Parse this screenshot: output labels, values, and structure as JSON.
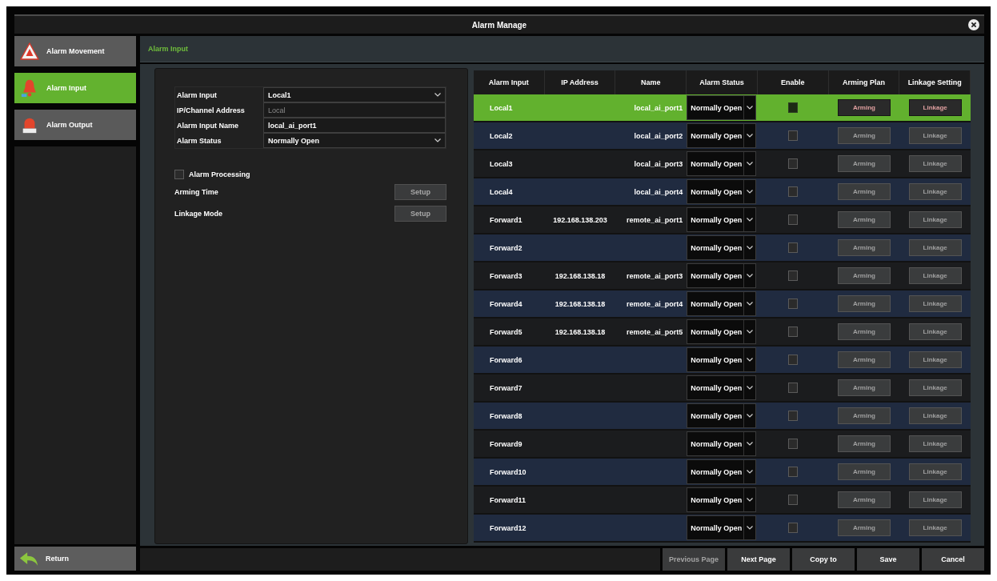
{
  "window": {
    "title": "Alarm Manage"
  },
  "sidebar": {
    "items": [
      {
        "kind": "event",
        "label": "Alarm Movement",
        "selected": false
      },
      {
        "kind": "input",
        "label": "Alarm Input",
        "selected": true
      },
      {
        "kind": "output",
        "label": "Alarm Output",
        "selected": false
      }
    ],
    "return": "Return"
  },
  "section_tab": "Alarm Input",
  "form": {
    "fields": [
      {
        "kind": "select",
        "label": "Alarm Input",
        "value": "Local1"
      },
      {
        "kind": "text",
        "label": "IP/Channel Address",
        "placeholder": "Local"
      },
      {
        "kind": "text",
        "label": "Alarm Input Name",
        "value": "local_ai_port1"
      },
      {
        "kind": "select",
        "label": "Alarm Status",
        "value": "Normally Open"
      }
    ],
    "processing": {
      "label": "Alarm Processing",
      "checked": false
    },
    "settings": [
      {
        "label": "Arming Time",
        "button": "Setup",
        "disabled": true
      },
      {
        "label": "Linkage Mode",
        "button": "Setup",
        "disabled": true
      }
    ]
  },
  "table": {
    "columns": [
      "Alarm Input",
      "IP Address",
      "Name",
      "Alarm Status",
      "Enable",
      "Arming Plan",
      "Linkage Setting"
    ],
    "rows": [
      {
        "input": "Local1",
        "name": "local_ai_port1",
        "status": "Normally Open",
        "enabled": false,
        "arming": "Arming",
        "linkage": "Linkage",
        "selected": true
      },
      {
        "input": "Local2",
        "name": "local_ai_port2",
        "status": "Normally Open",
        "enabled": false,
        "arming": "Arming",
        "linkage": "Linkage",
        "selected": false
      },
      {
        "input": "Local3",
        "name": "local_ai_port3",
        "status": "Normally Open",
        "enabled": false,
        "arming": "Arming",
        "linkage": "Linkage",
        "selected": false
      },
      {
        "input": "Local4",
        "name": "local_ai_port4",
        "status": "Normally Open",
        "enabled": false,
        "arming": "Arming",
        "linkage": "Linkage",
        "selected": false
      },
      {
        "input": "Forward1",
        "ip": "192.168.138.203",
        "name": "remote_ai_port1",
        "status": "Normally Open",
        "enabled": false,
        "arming": "Arming",
        "linkage": "Linkage",
        "selected": false
      },
      {
        "input": "Forward2",
        "status": "Normally Open",
        "enabled": false,
        "arming": "Arming",
        "linkage": "Linkage",
        "selected": false
      },
      {
        "input": "Forward3",
        "ip": "192.168.138.18",
        "name": "remote_ai_port3",
        "status": "Normally Open",
        "enabled": false,
        "arming": "Arming",
        "linkage": "Linkage",
        "selected": false
      },
      {
        "input": "Forward4",
        "ip": "192.168.138.18",
        "name": "remote_ai_port4",
        "status": "Normally Open",
        "enabled": false,
        "arming": "Arming",
        "linkage": "Linkage",
        "selected": false
      },
      {
        "input": "Forward5",
        "ip": "192.168.138.18",
        "name": "remote_ai_port5",
        "status": "Normally Open",
        "enabled": false,
        "arming": "Arming",
        "linkage": "Linkage",
        "selected": false
      },
      {
        "input": "Forward6",
        "status": "Normally Open",
        "enabled": false,
        "arming": "Arming",
        "linkage": "Linkage",
        "selected": false
      },
      {
        "input": "Forward7",
        "status": "Normally Open",
        "enabled": false,
        "arming": "Arming",
        "linkage": "Linkage",
        "selected": false
      },
      {
        "input": "Forward8",
        "status": "Normally Open",
        "enabled": false,
        "arming": "Arming",
        "linkage": "Linkage",
        "selected": false
      },
      {
        "input": "Forward9",
        "status": "Normally Open",
        "enabled": false,
        "arming": "Arming",
        "linkage": "Linkage",
        "selected": false
      },
      {
        "input": "Forward10",
        "status": "Normally Open",
        "enabled": false,
        "arming": "Arming",
        "linkage": "Linkage",
        "selected": false
      },
      {
        "input": "Forward11",
        "status": "Normally Open",
        "enabled": false,
        "arming": "Arming",
        "linkage": "Linkage",
        "selected": false
      },
      {
        "input": "Forward12",
        "status": "Normally Open",
        "enabled": false,
        "arming": "Arming",
        "linkage": "Linkage",
        "selected": false
      }
    ]
  },
  "footer": {
    "buttons": [
      {
        "label": "Previous Page",
        "disabled": true
      },
      {
        "label": "Next Page",
        "disabled": false
      },
      {
        "label": "Copy to",
        "disabled": false
      },
      {
        "label": "Save",
        "disabled": false
      },
      {
        "label": "Cancel",
        "disabled": false
      }
    ]
  }
}
